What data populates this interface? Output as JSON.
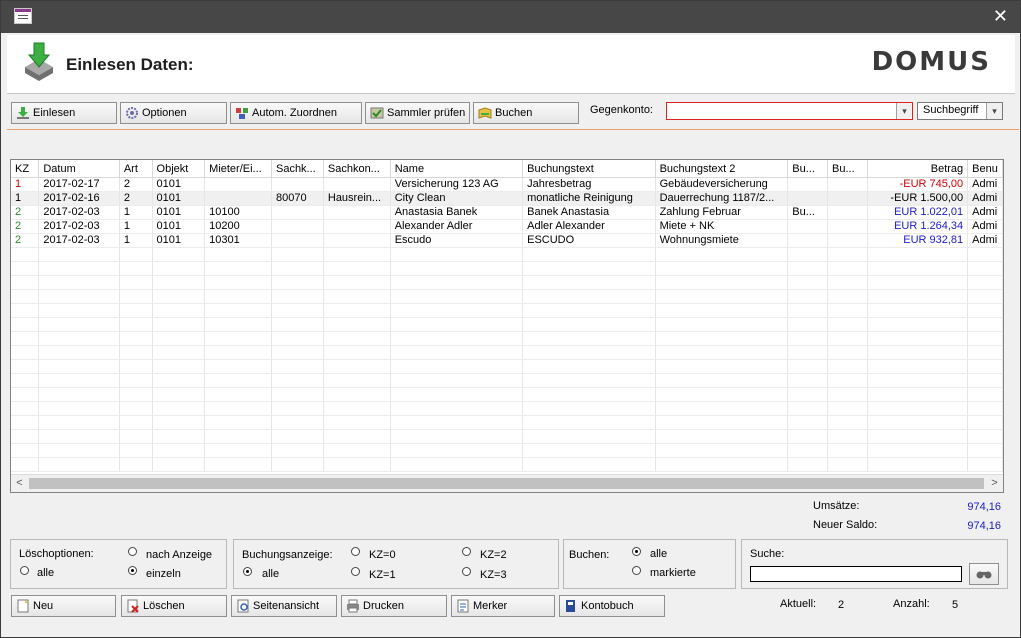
{
  "window": {
    "close_glyph": "✕"
  },
  "header": {
    "title": "Einlesen Daten:",
    "logo": "DOMUS"
  },
  "toolbar": {
    "buttons": [
      {
        "label": "Einlesen",
        "icon": "import-icon"
      },
      {
        "label": "Optionen",
        "icon": "gear-icon"
      },
      {
        "label": "Autom. Zuordnen",
        "icon": "assign-icon"
      },
      {
        "label": "Sammler prüfen",
        "icon": "check-icon"
      },
      {
        "label": "Buchen",
        "icon": "book-icon"
      }
    ],
    "gegenkonto_label": "Gegenkonto:",
    "gegenkonto_value": "",
    "search_mode_value": "Suchbegriff"
  },
  "grid": {
    "columns": [
      "KZ",
      "Datum",
      "Art",
      "Objekt",
      "Mieter/Ei...",
      "Sachk...",
      "Sachkon...",
      "Name",
      "Buchungstext",
      "Buchungstext 2",
      "Bu...",
      "Bu...",
      "Betrag",
      "Benu"
    ],
    "rows": [
      {
        "kz": "1",
        "kz_color": "red",
        "cells": [
          "2017-02-17",
          "2",
          "0101",
          "",
          "",
          "",
          "Versicherung 123 AG",
          "Jahresbetrag",
          "Gebäudeversicherung",
          "",
          "",
          "-EUR 745,00",
          "Admi"
        ],
        "amount_color": "red",
        "selected": false
      },
      {
        "kz": "1",
        "kz_color": "black",
        "cells": [
          "2017-02-16",
          "2",
          "0101",
          "",
          "80070",
          "Hausrein...",
          "City Clean",
          "monatliche Reinigung",
          "Dauerrechung 1187/2...",
          "",
          "",
          "-EUR 1.500,00",
          "Admi"
        ],
        "amount_color": "black",
        "selected": true
      },
      {
        "kz": "2",
        "kz_color": "green",
        "cells": [
          "2017-02-03",
          "1",
          "0101",
          "10100",
          "",
          "",
          "Anastasia Banek",
          "Banek Anastasia",
          "Zahlung Februar",
          "Bu...",
          "",
          "EUR 1.022,01",
          "Admi"
        ],
        "amount_color": "blue",
        "selected": false
      },
      {
        "kz": "2",
        "kz_color": "green",
        "cells": [
          "2017-02-03",
          "1",
          "0101",
          "10200",
          "",
          "",
          "Alexander Adler",
          "Adler Alexander",
          "Miete + NK",
          "",
          "",
          "EUR 1.264,34",
          "Admi"
        ],
        "amount_color": "blue",
        "selected": false
      },
      {
        "kz": "2",
        "kz_color": "green",
        "cells": [
          "2017-02-03",
          "1",
          "0101",
          "10301",
          "",
          "",
          "Escudo",
          "ESCUDO",
          "Wohnungsmiete",
          "",
          "",
          "EUR 932,81",
          "Admi"
        ],
        "amount_color": "blue",
        "selected": false
      }
    ]
  },
  "totals": {
    "umsaetze_label": "Umsätze:",
    "umsaetze_value": "974,16",
    "saldo_label": "Neuer Saldo:",
    "saldo_value": "974,16"
  },
  "loeschoptionen": {
    "label": "Löschoptionen:",
    "alle": "alle",
    "nach_anzeige": "nach Anzeige",
    "einzeln": "einzeln",
    "selected": "einzeln"
  },
  "buchungsanzeige": {
    "label": "Buchungsanzeige:",
    "alle": "alle",
    "kz0": "KZ=0",
    "kz1": "KZ=1",
    "kz2": "KZ=2",
    "kz3": "KZ=3",
    "selected": "alle"
  },
  "buchen": {
    "label": "Buchen:",
    "alle": "alle",
    "markierte": "markierte",
    "selected": "alle"
  },
  "suche": {
    "label": "Suche:",
    "value": ""
  },
  "bottom_buttons": [
    {
      "label": "Neu",
      "icon": "new-icon"
    },
    {
      "label": "Löschen",
      "icon": "delete-icon"
    },
    {
      "label": "Seitenansicht",
      "icon": "preview-icon"
    },
    {
      "label": "Drucken",
      "icon": "print-icon"
    },
    {
      "label": "Merker",
      "icon": "marker-icon"
    },
    {
      "label": "Kontobuch",
      "icon": "account-book-icon"
    }
  ],
  "status": {
    "aktuell_label": "Aktuell:",
    "aktuell_value": "2",
    "anzahl_label": "Anzahl:",
    "anzahl_value": "5"
  }
}
